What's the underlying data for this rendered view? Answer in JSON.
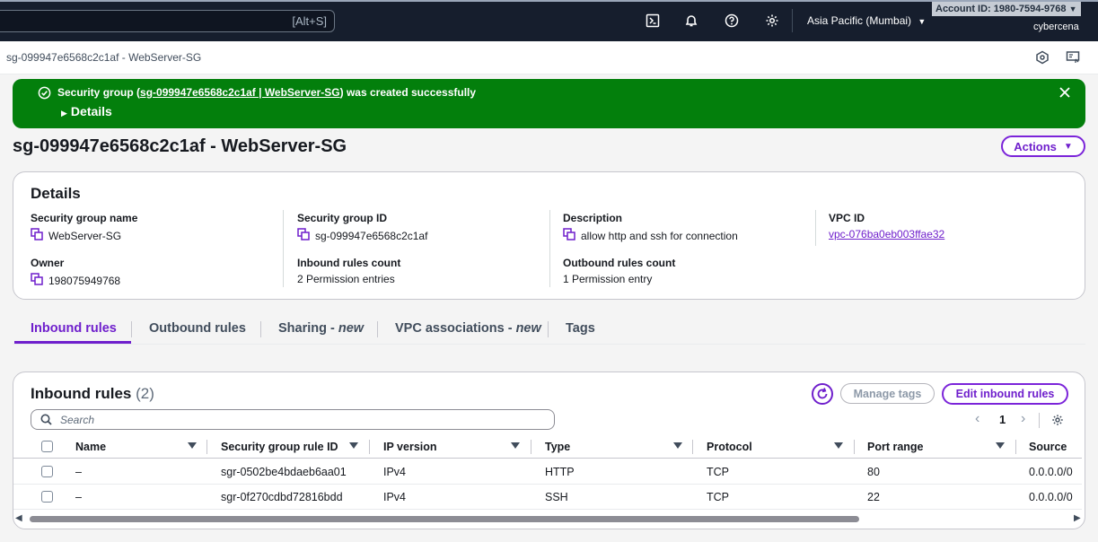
{
  "topnav": {
    "search_shortcut": "[Alt+S]",
    "region": "Asia Pacific (Mumbai)",
    "account": "Account ID: 1980-7594-9768",
    "user": "cybercena"
  },
  "breadcrumb": "sg-099947e6568c2c1af - WebServer-SG",
  "flash": {
    "prefix": "Security group (",
    "link": "sg-099947e6568c2c1af | WebServer-SG",
    "suffix": ") was created successfully",
    "details": "Details",
    "color": "#037f0c"
  },
  "page_title": "sg-099947e6568c2c1af - WebServer-SG",
  "actions_label": "Actions",
  "details": {
    "heading": "Details",
    "sg_name_label": "Security group name",
    "sg_name": "WebServer-SG",
    "sg_id_label": "Security group ID",
    "sg_id": "sg-099947e6568c2c1af",
    "desc_label": "Description",
    "desc": "allow http and ssh for connection",
    "vpc_label": "VPC ID",
    "vpc": "vpc-076ba0eb003ffae32",
    "owner_label": "Owner",
    "owner": "198075949768",
    "inbound_label": "Inbound rules count",
    "inbound": "2 Permission entries",
    "outbound_label": "Outbound rules count",
    "outbound": "1 Permission entry"
  },
  "tabs": {
    "inbound": "Inbound rules",
    "outbound": "Outbound rules",
    "sharing": "Sharing - ",
    "sharing_new": "new",
    "vpc_assoc": "VPC associations - ",
    "vpc_assoc_new": "new",
    "tags": "Tags"
  },
  "rules": {
    "title": "Inbound rules",
    "count": "(2)",
    "manage_tags": "Manage tags",
    "edit": "Edit inbound rules",
    "search_placeholder": "Search",
    "page": "1",
    "columns": {
      "name": "Name",
      "rule_id": "Security group rule ID",
      "ip_version": "IP version",
      "type": "Type",
      "protocol": "Protocol",
      "port_range": "Port range",
      "source": "Source"
    },
    "rows": [
      {
        "name": "–",
        "rule_id": "sgr-0502be4bdaeb6aa01",
        "ip_version": "IPv4",
        "type": "HTTP",
        "protocol": "TCP",
        "port_range": "80",
        "source": "0.0.0.0/0"
      },
      {
        "name": "–",
        "rule_id": "sgr-0f270cdbd72816bdd",
        "ip_version": "IPv4",
        "type": "SSH",
        "protocol": "TCP",
        "port_range": "22",
        "source": "0.0.0.0/0"
      }
    ]
  },
  "colors": {
    "accent": "#6f1fcc",
    "nav": "#161e2d",
    "success": "#037f0c"
  }
}
